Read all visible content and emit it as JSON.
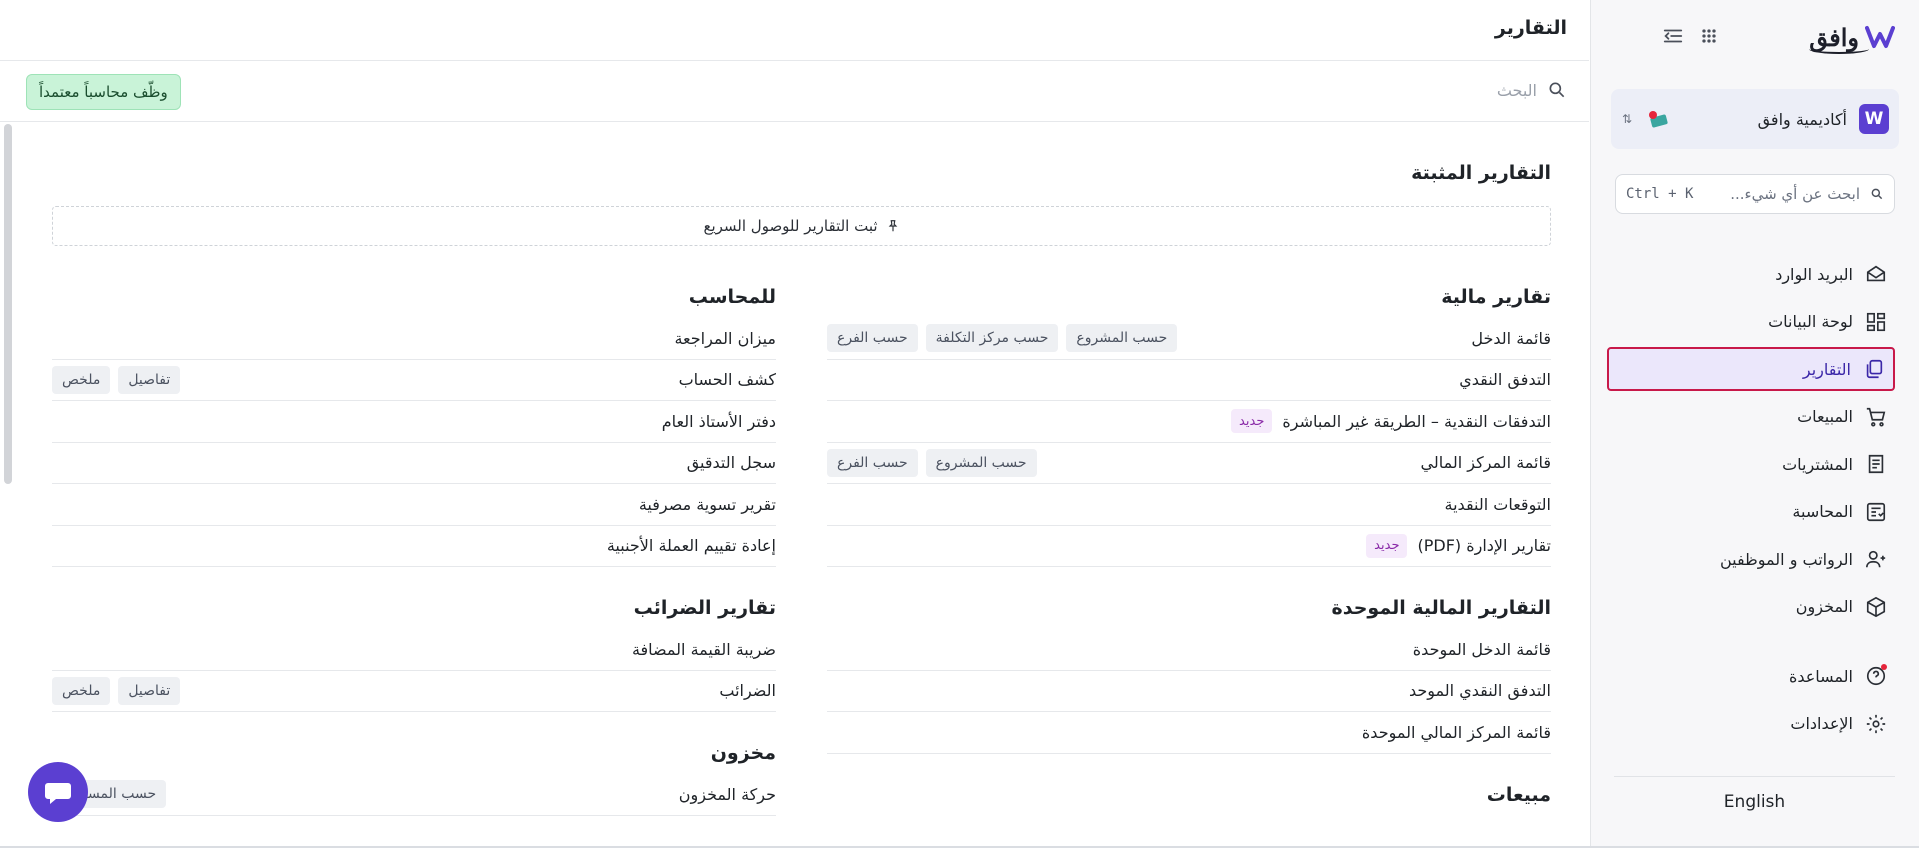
{
  "sidebar": {
    "brand": "وافق",
    "workspace": {
      "name": "أكاديمية وافق",
      "logo_letter": "W"
    },
    "search": {
      "placeholder": "ابحث عن أي شيء...",
      "shortcut": "Ctrl + K"
    },
    "items": [
      {
        "label": "البريد الوارد",
        "icon": "inbox-icon"
      },
      {
        "label": "لوحة البيانات",
        "icon": "dashboard-icon"
      },
      {
        "label": "التقارير",
        "icon": "reports-icon",
        "active": true
      },
      {
        "label": "المبيعات",
        "icon": "cart-icon"
      },
      {
        "label": "المشتريات",
        "icon": "receipt-icon"
      },
      {
        "label": "المحاسبة",
        "icon": "ledger-icon"
      },
      {
        "label": "الرواتب و الموظفين",
        "icon": "users-icon"
      },
      {
        "label": "المخزون",
        "icon": "box-icon"
      }
    ],
    "bottom_items": [
      {
        "label": "المساعدة",
        "icon": "help-icon"
      },
      {
        "label": "الإعدادات",
        "icon": "gear-icon"
      }
    ],
    "language": "English"
  },
  "main": {
    "title": "التقارير",
    "search_placeholder": "البحث",
    "hire_button": "وظّف محاسباً معتمداً",
    "pinned": {
      "title": "التقارير المثبتة",
      "empty_text": "ثبت التقارير للوصول السريع"
    },
    "right_groups": [
      {
        "title": "تقارير مالية",
        "rows": [
          {
            "label": "قائمة الدخل",
            "tags": [
              "حسب الفرع",
              "حسب مركز التكلفة",
              "حسب المشروع"
            ]
          },
          {
            "label": "التدفق النقدي"
          },
          {
            "label": "التدفقات النقدية – الطريقة غير المباشرة",
            "badge": "جديد"
          },
          {
            "label": "قائمة المركز المالي",
            "tags": [
              "حسب الفرع",
              "حسب المشروع"
            ]
          },
          {
            "label": "التوقعات النقدية"
          },
          {
            "label": "تقارير الإدارة (PDF)",
            "badge": "جديد"
          }
        ]
      },
      {
        "title": "التقارير المالية الموحدة",
        "rows": [
          {
            "label": "قائمة الدخل الموحدة"
          },
          {
            "label": "التدفق النقدي الموحد"
          },
          {
            "label": "قائمة المركز المالي الموحدة"
          }
        ]
      },
      {
        "title": "مبيعات",
        "rows": []
      }
    ],
    "left_groups": [
      {
        "title": "للمحاسب",
        "rows": [
          {
            "label": "ميزان المراجعة"
          },
          {
            "label": "كشف الحساب",
            "tags": [
              "ملخص",
              "تفاصيل"
            ]
          },
          {
            "label": "دفتر الأستاذ العام"
          },
          {
            "label": "سجل التدقيق"
          },
          {
            "label": "تقرير تسوية مصرفية"
          },
          {
            "label": "إعادة تقييم العملة الأجنبية"
          }
        ]
      },
      {
        "title": "تقارير الضرائب",
        "rows": [
          {
            "label": "ضريبة القيمة المضافة"
          },
          {
            "label": "الضرائب",
            "tags": [
              "ملخص",
              "تفاصيل"
            ]
          }
        ]
      },
      {
        "title": "مخزون",
        "rows": [
          {
            "label": "حركة المخزون",
            "tags": [
              "حسب المستودع"
            ]
          }
        ]
      }
    ]
  },
  "colors": {
    "accent": "#5b3fd1",
    "active_bg": "#ebe7fb",
    "active_border": "#c8194a",
    "hire_bg": "#c9f3d8",
    "badge_text": "#8a2aa8"
  }
}
